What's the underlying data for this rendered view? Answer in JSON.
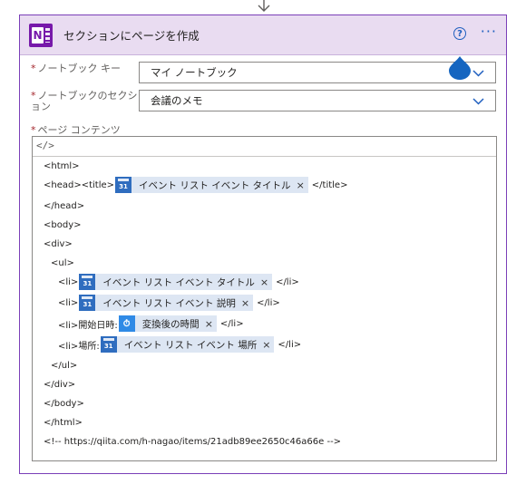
{
  "card": {
    "title": "セクションにページを作成",
    "help_glyph": "?",
    "more_glyph": "···",
    "app_icon_letter": "N",
    "accent_color": "#7719aa"
  },
  "fields": [
    {
      "label": "ノートブック キー",
      "value": "マイ ノートブック"
    },
    {
      "label": "ノートブックのセクション",
      "value": "会議のメモ"
    }
  ],
  "content_label": "ページ コンテンツ",
  "required_mark": "*",
  "editor": {
    "toolbar_icon": "</>",
    "lines": {
      "l1": "<html>",
      "l2_pre": "<head><title>",
      "l2_post": "</title>",
      "l3": "</head>",
      "l4": "<body>",
      "l5": "<div>",
      "l6": "<ul>",
      "l7_pre": "<li>",
      "l7_post": "</li>",
      "l8_pre": "<li>",
      "l8_post": "</li>",
      "l9_pre": "<li>開始日時:",
      "l9_post": "</li>",
      "l10_pre": "<li>場所:",
      "l10_post": "</li>",
      "l11": "</ul>",
      "l12": "</div>",
      "l13": "</body>",
      "l14": "</html>",
      "l15": "<!-- https://qiita.com/h-nagao/items/21adb89ee2650c46a66e -->"
    },
    "tokens": {
      "title": "イベント リスト イベント タイトル",
      "li_title": "イベント リスト イベント タイトル",
      "li_desc": "イベント リスト イベント 説明",
      "start_time": "変換後の時間",
      "location": "イベント リスト イベント 場所"
    },
    "calendar_icon_text": "31",
    "remove_glyph": "×"
  }
}
